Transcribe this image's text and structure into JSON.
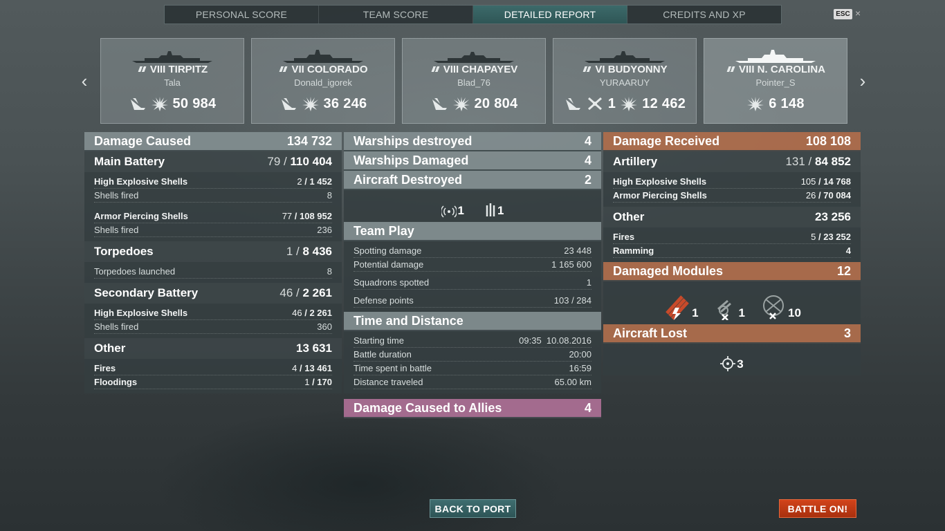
{
  "tabs": [
    "PERSONAL SCORE",
    "TEAM SCORE",
    "DETAILED REPORT",
    "CREDITS AND XP"
  ],
  "esc": "ESC",
  "close": "×",
  "nav": {
    "prev": "‹",
    "next": "›"
  },
  "ships": [
    {
      "name": "VIII TIRPITZ",
      "player": "Tala",
      "sunk": "",
      "damage": "50 984"
    },
    {
      "name": "VII COLORADO",
      "player": "Donald_igorek",
      "sunk": "",
      "damage": "36 246"
    },
    {
      "name": "VIII CHAPAYEV",
      "player": "Blad_76",
      "sunk": "",
      "damage": "20 804"
    },
    {
      "name": "VI BUDYONNY",
      "player": "YURAARUY",
      "sunk": "1",
      "damage": "12 462"
    },
    {
      "name": "VIII N. CAROLINA",
      "player": "Pointer_S",
      "sunk": "",
      "damage": "6 148"
    }
  ],
  "left": {
    "damage_caused": {
      "label": "Damage Caused",
      "value": "134 732"
    },
    "main_battery": {
      "label": "Main Battery",
      "hits": "79",
      "value": "110 404"
    },
    "mb_he": {
      "label": "High Explosive Shells",
      "hits": "2",
      "value": "1 452"
    },
    "mb_he_fired": {
      "label": "Shells fired",
      "value": "8"
    },
    "mb_ap": {
      "label": "Armor Piercing Shells",
      "hits": "77",
      "value": "108 952"
    },
    "mb_ap_fired": {
      "label": "Shells fired",
      "value": "236"
    },
    "torpedoes": {
      "label": "Torpedoes",
      "hits": "1",
      "value": "8 436"
    },
    "torp_launched": {
      "label": "Torpedoes launched",
      "value": "8"
    },
    "secondary": {
      "label": "Secondary Battery",
      "hits": "46",
      "value": "2 261"
    },
    "sec_he": {
      "label": "High Explosive Shells",
      "hits": "46",
      "value": "2 261"
    },
    "sec_fired": {
      "label": "Shells fired",
      "value": "360"
    },
    "other": {
      "label": "Other",
      "value": "13 631"
    },
    "fires": {
      "label": "Fires",
      "hits": "4",
      "value": "13 461"
    },
    "floodings": {
      "label": "Floodings",
      "hits": "1",
      "value": "170"
    }
  },
  "middle": {
    "warships_destroyed": {
      "label": "Warships destroyed",
      "value": "4"
    },
    "warships_damaged": {
      "label": "Warships Damaged",
      "value": "4"
    },
    "aircraft_destroyed": {
      "label": "Aircraft Destroyed",
      "value": "2"
    },
    "aircraft_icons": {
      "radio": "1",
      "aa": "1"
    },
    "team_play": {
      "label": "Team Play"
    },
    "spotting": {
      "label": "Spotting damage",
      "value": "23 448"
    },
    "potential": {
      "label": "Potential damage",
      "value": "1 165 600"
    },
    "squadrons": {
      "label": "Squadrons spotted",
      "value": "1"
    },
    "defense": {
      "label": "Defense points",
      "value": "103 / 284"
    },
    "time_distance": {
      "label": "Time and Distance"
    },
    "start": {
      "label": "Starting time",
      "value": "09:35  10.08.2016"
    },
    "duration": {
      "label": "Battle duration",
      "value": "20:00"
    },
    "spent": {
      "label": "Time spent in battle",
      "value": "16:59"
    },
    "distance": {
      "label": "Distance traveled",
      "value": "65.00 km"
    },
    "allies": {
      "label": "Damage Caused to Allies",
      "value": "4"
    }
  },
  "right": {
    "damage_received": {
      "label": "Damage Received",
      "value": "108 108"
    },
    "artillery": {
      "label": "Artillery",
      "hits": "131",
      "value": "84 852"
    },
    "art_he": {
      "label": "High Explosive Shells",
      "hits": "105",
      "value": "14 768"
    },
    "art_ap": {
      "label": "Armor Piercing Shells",
      "hits": "26",
      "value": "70 084"
    },
    "other": {
      "label": "Other",
      "value": "23 256"
    },
    "fires": {
      "label": "Fires",
      "hits": "5",
      "value": "23 252"
    },
    "ramming": {
      "label": "Ramming",
      "value": "4"
    },
    "modules": {
      "label": "Damaged Modules",
      "value": "12"
    },
    "module_icons": {
      "torpedo": "1",
      "turret": "1",
      "aa": "10"
    },
    "aircraft_lost": {
      "label": "Aircraft Lost",
      "value": "3"
    },
    "aircraft_lost_icon": "3"
  },
  "buttons": {
    "back": "BACK TO PORT",
    "battle": "BATTLE ON!"
  },
  "colors": {
    "accent_teal": "#2f5656",
    "battle_red": "#c03a14",
    "received_orange": "#b06e4c",
    "allies_pink": "#aa6e92"
  }
}
